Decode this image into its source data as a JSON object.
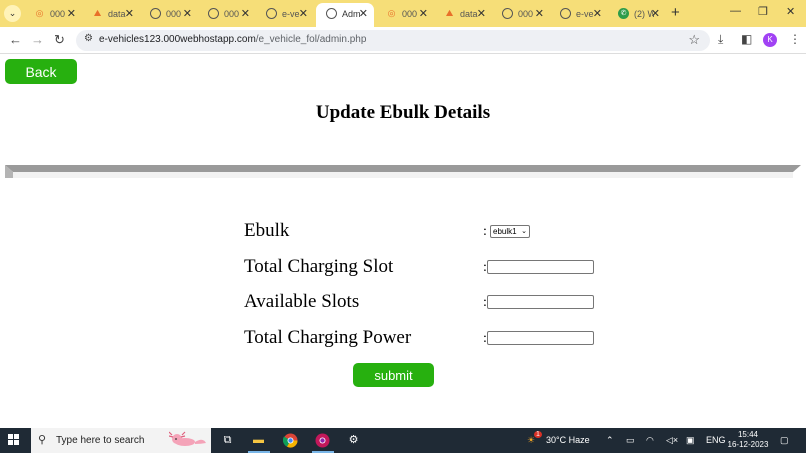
{
  "browser": {
    "tabs": [
      {
        "title": "000",
        "favicon": "orange-icon"
      },
      {
        "title": "data",
        "favicon": "orange-icon"
      },
      {
        "title": "000",
        "favicon": "globe-icon"
      },
      {
        "title": "000",
        "favicon": "globe-icon"
      },
      {
        "title": "e-ve",
        "favicon": "globe-icon"
      },
      {
        "title": "Adm",
        "favicon": "globe-icon",
        "active": true
      },
      {
        "title": "000",
        "favicon": "orange-icon"
      },
      {
        "title": "data",
        "favicon": "orange-icon"
      },
      {
        "title": "000",
        "favicon": "globe-icon"
      },
      {
        "title": "e-ve",
        "favicon": "globe-icon"
      },
      {
        "title": "(2) W",
        "favicon": "whatsapp-icon"
      }
    ],
    "url_host": "e-vehicles123.000webhostapp.com",
    "url_path": "/e_vehicle_fol/admin.php",
    "profile_initial": "K"
  },
  "page": {
    "back_label": "Back",
    "title": "Update Ebulk Details",
    "form": {
      "ebulk_label": "Ebulk",
      "ebulk_selected": "ebulk1",
      "total_slot_label": "Total Charging Slot",
      "available_slots_label": "Available Slots",
      "total_power_label": "Total Charging Power",
      "colon": ":",
      "submit_label": "submit"
    }
  },
  "taskbar": {
    "search_placeholder": "Type here to search",
    "weather": "30°C  Haze",
    "weather_badge": "1",
    "language": "ENG",
    "time": "15:44",
    "date": "16-12-2023"
  },
  "colors": {
    "accent_green": "#27b00f",
    "tabstrip_yellow": "#f6de78",
    "taskbar_dark": "#1f2a35"
  }
}
